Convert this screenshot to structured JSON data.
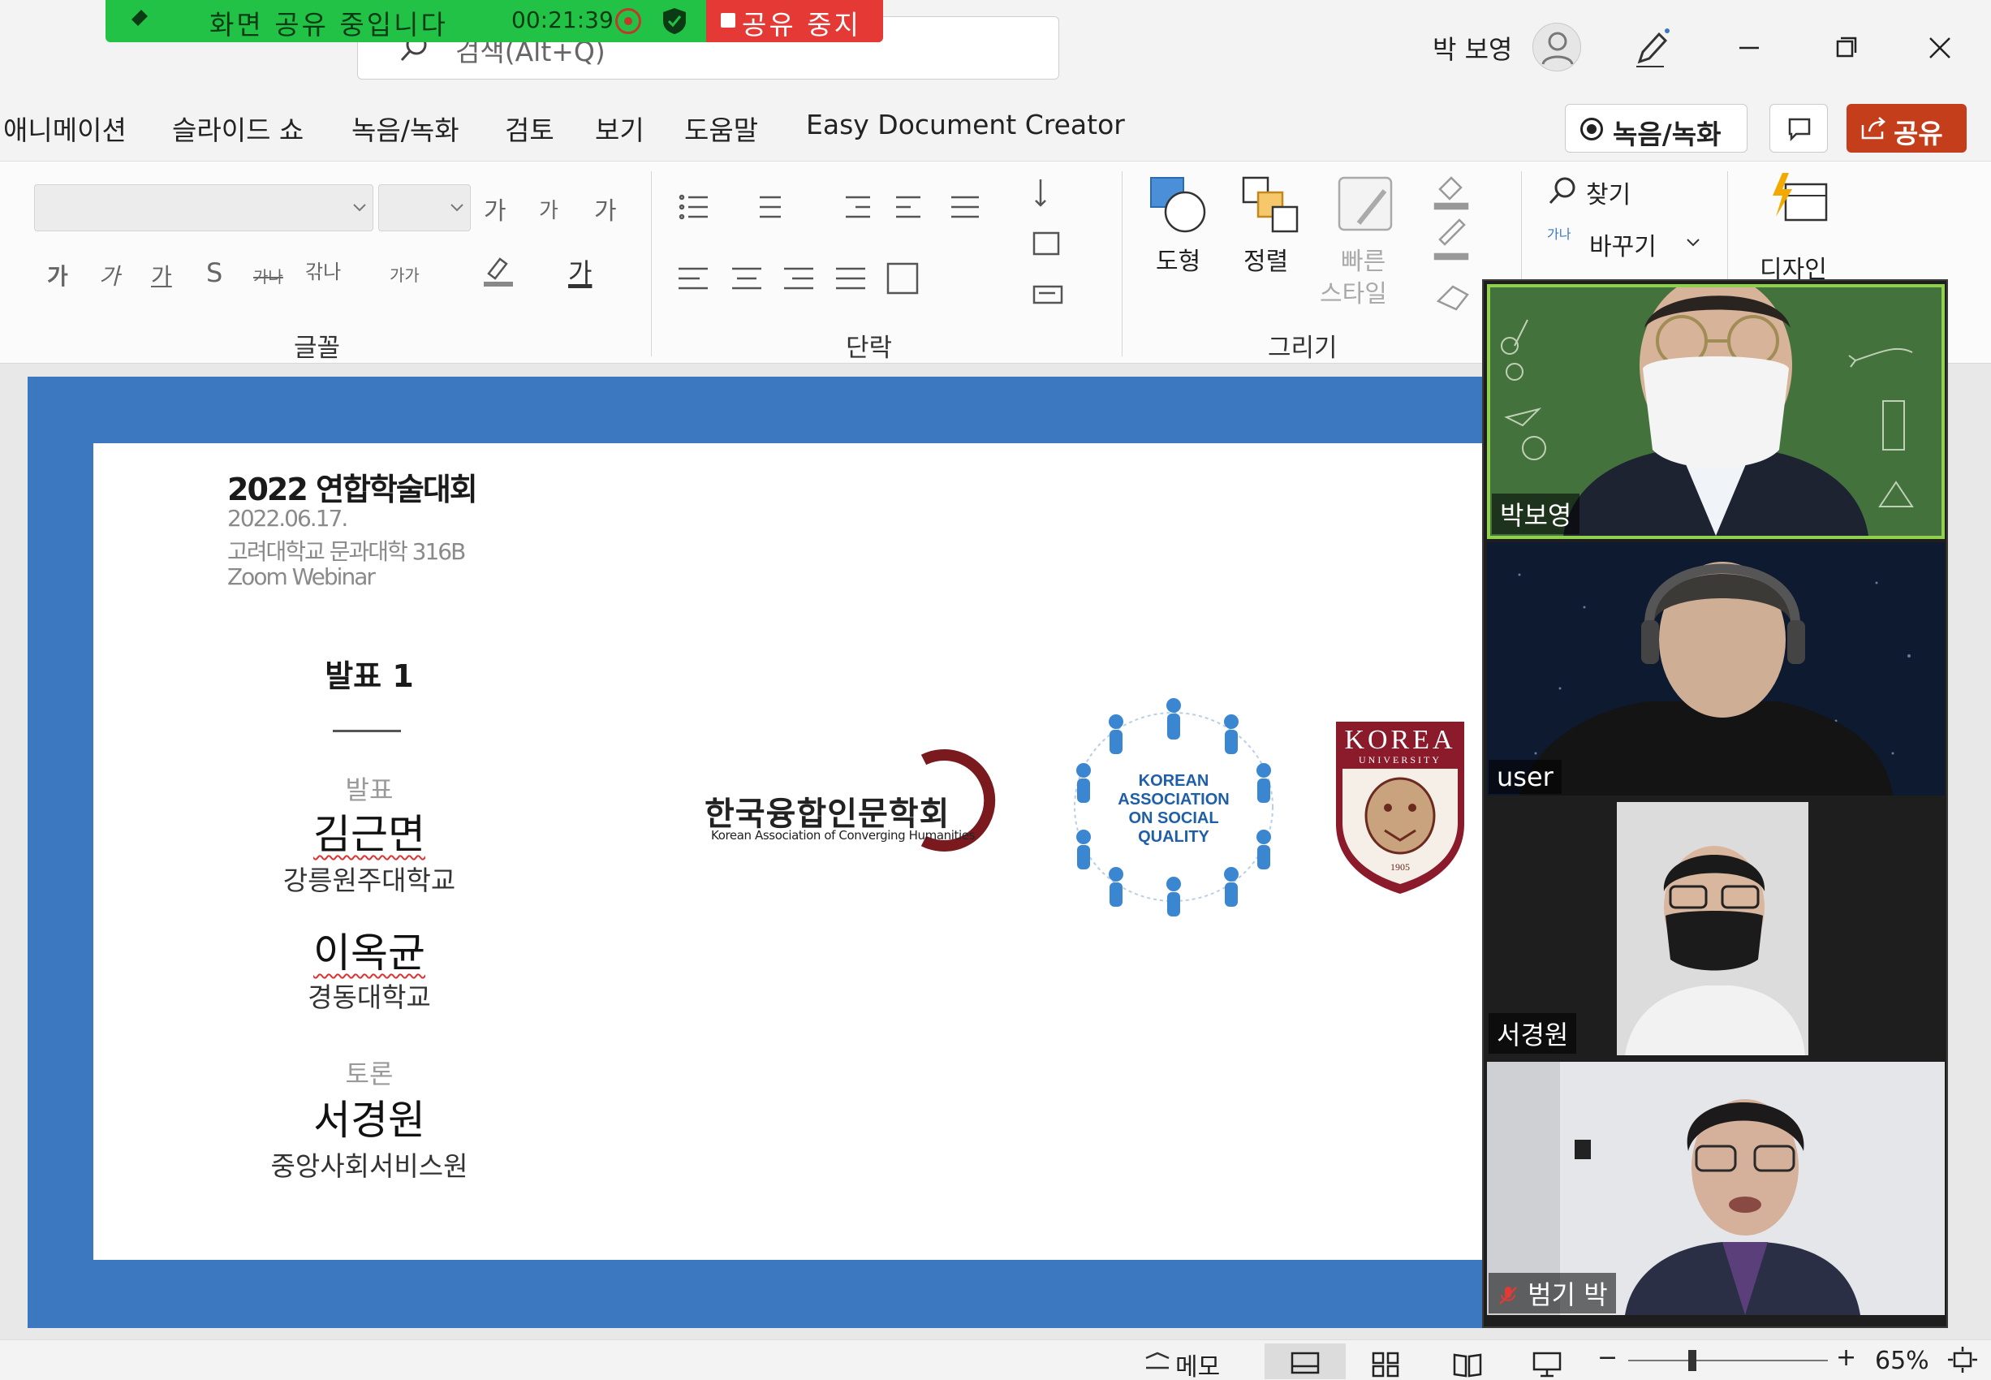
{
  "share_bar": {
    "label": "화면 공유 중입니다",
    "timer": "00:21:39",
    "stop_label": "공유 중지"
  },
  "search": {
    "placeholder": "검색(Alt+Q)"
  },
  "user": {
    "name": "박 보영"
  },
  "menu_tabs": [
    "애니메이션",
    "슬라이드 쇼",
    "녹음/녹화",
    "검토",
    "보기",
    "도움말",
    "Easy Document Creator"
  ],
  "header_buttons": {
    "record": "녹음/녹화",
    "share": "공유"
  },
  "ribbon": {
    "font_group": {
      "label": "글꼴",
      "grow": "가",
      "shrink": "가",
      "clear": "가",
      "bold": "가",
      "italic": "가",
      "underline": "가",
      "shadow": "S",
      "strike": "가나",
      "spacing": "갂나",
      "case": "가가",
      "font_color": "가"
    },
    "paragraph_group": {
      "label": "단락"
    },
    "drawing_group": {
      "label": "그리기",
      "shapes": "도형",
      "arrange": "정렬",
      "quick_styles_1": "빠른",
      "quick_styles_2": "스타일"
    },
    "editing": {
      "find": "찾기",
      "replace": "바꾸기",
      "replace_icon_text": "가나"
    },
    "designer": {
      "label": "디자인"
    }
  },
  "slide": {
    "title": "2022 연합학술대회",
    "date": "2022.06.17.",
    "venue": "고려대학교 문과대학 316B",
    "platform": "Zoom Webinar",
    "heading": "발표 1",
    "presenter_role": "발표",
    "presenters": [
      {
        "name": "김근면",
        "affiliation": "강릉원주대학교"
      },
      {
        "name": "이옥균",
        "affiliation": "경동대학교"
      }
    ],
    "discussant_role": "토론",
    "discussant": {
      "name": "서경원",
      "affiliation": "중앙사회서비스원"
    },
    "logos": {
      "khum_ko": "한국융합인문학회",
      "khum_en": "Korean Association of Converging Humanities",
      "kasq_line1": "KOREAN",
      "kasq_line2": "ASSOCIATION",
      "kasq_line3": "ON SOCIAL",
      "kasq_line4": "QUALITY",
      "korea_1": "KOREA",
      "korea_2": "UNIVERSITY",
      "korea_year": "1905"
    }
  },
  "participants": [
    {
      "name": "박보영"
    },
    {
      "name": "user"
    },
    {
      "name": "서경원"
    },
    {
      "name": "범기 박"
    }
  ],
  "status_bar": {
    "notes": "메모",
    "zoom": "65%"
  },
  "colors": {
    "slide_border": "#3b78c0",
    "share_green": "#22c246",
    "stop_red": "#e53935",
    "share_button": "#c43e1c",
    "speaker_border": "#8fd14f"
  }
}
